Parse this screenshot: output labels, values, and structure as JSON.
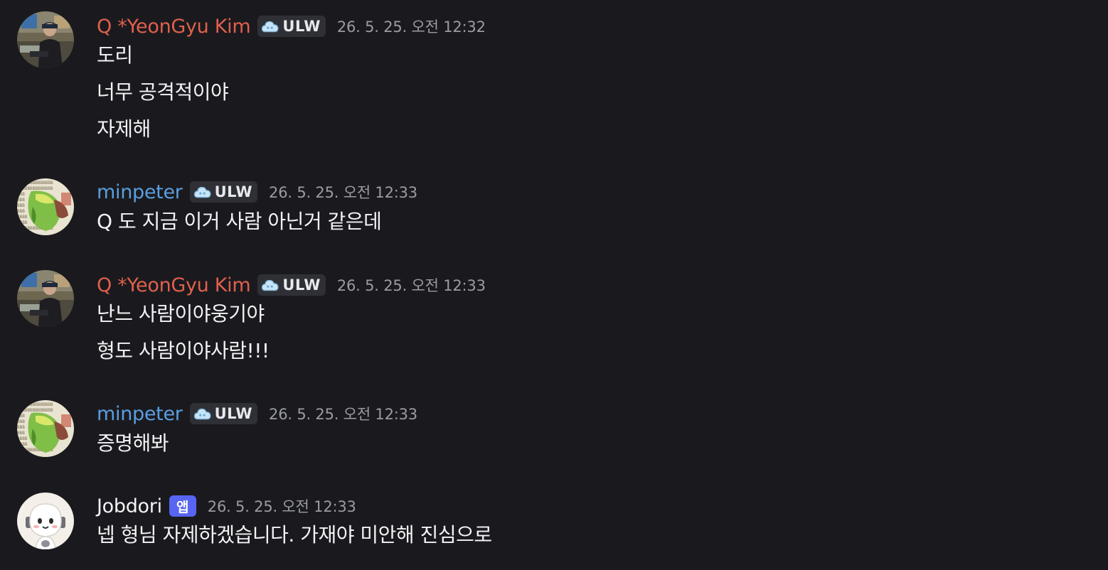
{
  "colors": {
    "background": "#1a1a1e",
    "yeongyu_name": "#e0604c",
    "minpeter_name": "#5a9ee0",
    "jobdori_name": "#f2f3f5",
    "app_tag": "#5865f2"
  },
  "messages": [
    {
      "author": "Q *YeonGyu Kim",
      "badge": "ULW",
      "badge_icon": "cloud-icon",
      "timestamp": "26. 5. 25. 오전 12:32",
      "lines": [
        "도리",
        "너무 공격적이야",
        "자제해"
      ]
    },
    {
      "author": "minpeter",
      "badge": "ULW",
      "badge_icon": "cloud-icon",
      "timestamp": "26. 5. 25. 오전 12:33",
      "lines": [
        "Q 도 지금 이거 사람 아닌거 같은데"
      ]
    },
    {
      "author": "Q *YeonGyu Kim",
      "badge": "ULW",
      "badge_icon": "cloud-icon",
      "timestamp": "26. 5. 25. 오전 12:33",
      "lines": [
        "난느 사람이야웅기야",
        "형도 사람이야사람!!!"
      ]
    },
    {
      "author": "minpeter",
      "badge": "ULW",
      "badge_icon": "cloud-icon",
      "timestamp": "26. 5. 25. 오전 12:33",
      "lines": [
        "증명해봐"
      ]
    },
    {
      "author": "Jobdori",
      "app_tag": "앱",
      "timestamp": "26. 5. 25. 오전 12:33",
      "lines": [
        "넵 형님 자제하겠습니다. 가재야 미안해 진심으로"
      ]
    }
  ]
}
